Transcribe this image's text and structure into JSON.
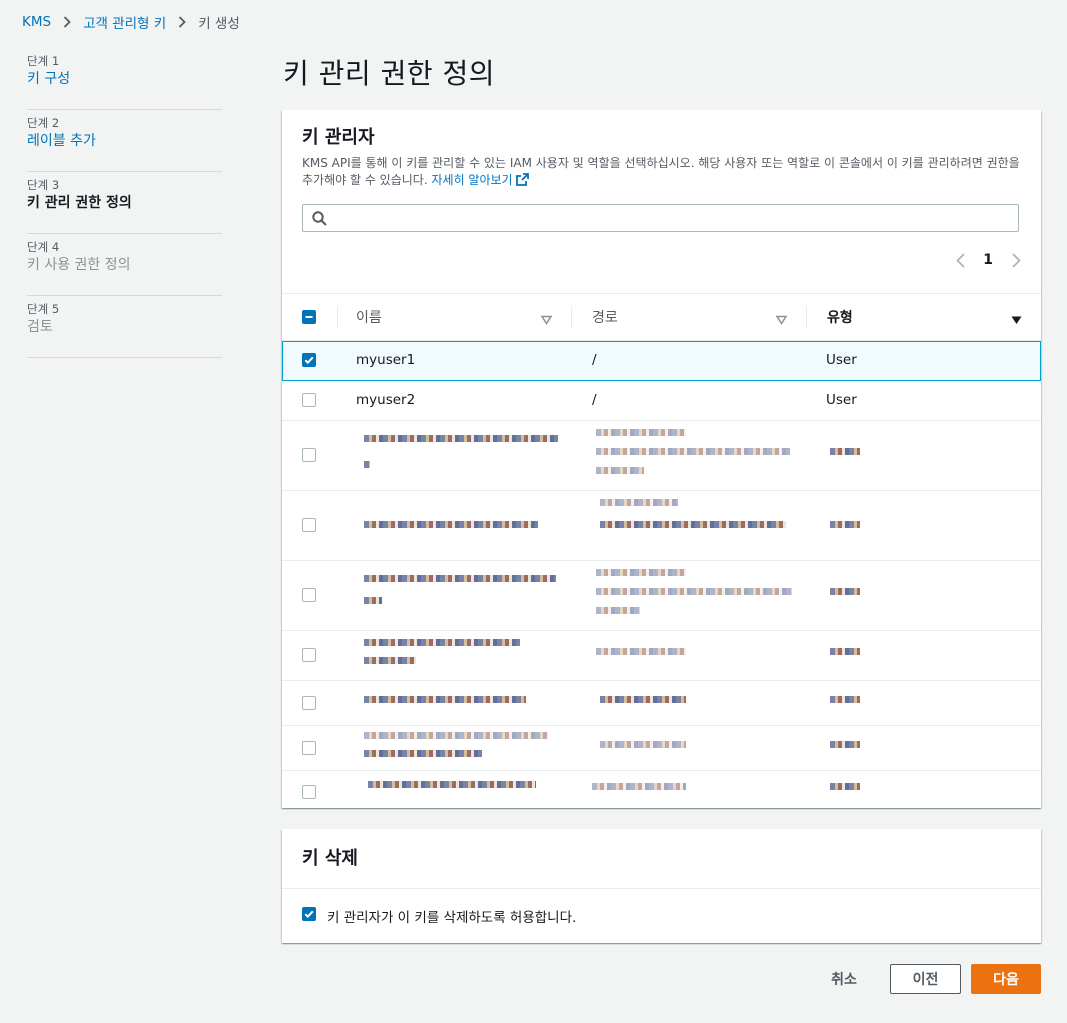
{
  "breadcrumb": {
    "items": [
      "KMS",
      "고객 관리형 키",
      "키 생성"
    ]
  },
  "steps": [
    {
      "num": "단계 1",
      "title": "키 구성",
      "state": "link"
    },
    {
      "num": "단계 2",
      "title": "레이블 추가",
      "state": "link"
    },
    {
      "num": "단계 3",
      "title": "키 관리 권한 정의",
      "state": "active"
    },
    {
      "num": "단계 4",
      "title": "키 사용 권한 정의",
      "state": "disabled"
    },
    {
      "num": "단계 5",
      "title": "검토",
      "state": "disabled"
    }
  ],
  "page_title": "키 관리 권한 정의",
  "admins_panel": {
    "title": "키 관리자",
    "description": "KMS API를 통해 이 키를 관리할 수 있는 IAM 사용자 및 역할을 선택하십시오. 해당 사용자 또는 역할로 이 콘솔에서 이 키를 관리하려면 권한을 추가해야 할 수 있습니다.",
    "learn_more": "자세히 알아보기",
    "search": {
      "value": "",
      "placeholder": ""
    },
    "pagination": {
      "current_page": "1"
    },
    "columns": {
      "name": "이름",
      "path": "경로",
      "type": "유형"
    },
    "rows": [
      {
        "name": "myuser1",
        "path": "/",
        "type": "User",
        "checked": true
      },
      {
        "name": "myuser2",
        "path": "/",
        "type": "User",
        "checked": false
      }
    ]
  },
  "delete_panel": {
    "title": "키 삭제",
    "allow_label": "키 관리자가 이 키를 삭제하도록 허용합니다.",
    "allow_checked": true
  },
  "footer": {
    "cancel": "취소",
    "previous": "이전",
    "next": "다음"
  },
  "colors": {
    "link": "#0073bb",
    "primary": "#ec7211",
    "background": "#f2f3f3"
  }
}
